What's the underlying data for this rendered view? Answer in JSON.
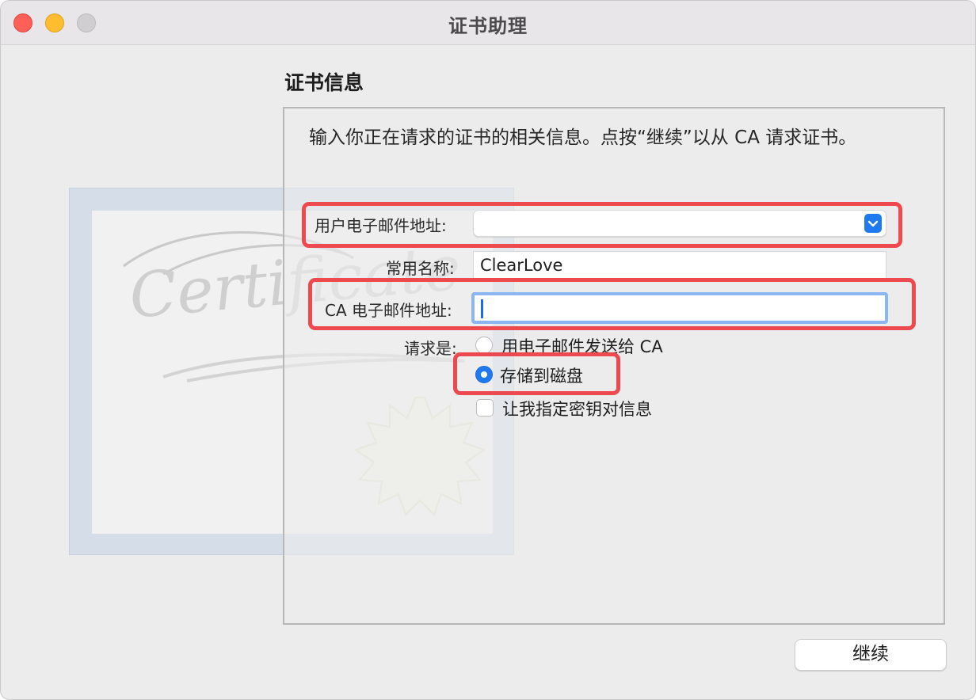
{
  "window": {
    "title": "证书助理"
  },
  "section": {
    "title": "证书信息",
    "intro": "输入你正在请求的证书的相关信息。点按“继续”以从 CA 请求证书。"
  },
  "form": {
    "user_email_label": "用户电子邮件地址:",
    "user_email_value": "",
    "common_name_label": "常用名称:",
    "common_name_value": "ClearLove",
    "ca_email_label": "CA 电子邮件地址:",
    "ca_email_value": "",
    "request_label": "请求是:",
    "request_options": [
      {
        "label": "用电子邮件发送给 CA",
        "selected": false
      },
      {
        "label": "存储到磁盘",
        "selected": true
      }
    ],
    "key_pair_checkbox_label": "让我指定密钥对信息",
    "key_pair_checked": false
  },
  "footer": {
    "continue_label": "继续"
  },
  "illustration": {
    "text": "Certificate"
  },
  "colors": {
    "accent": "#1f7af0",
    "highlight": "#ec4a4f",
    "focus_ring": "#8cb6f2"
  }
}
